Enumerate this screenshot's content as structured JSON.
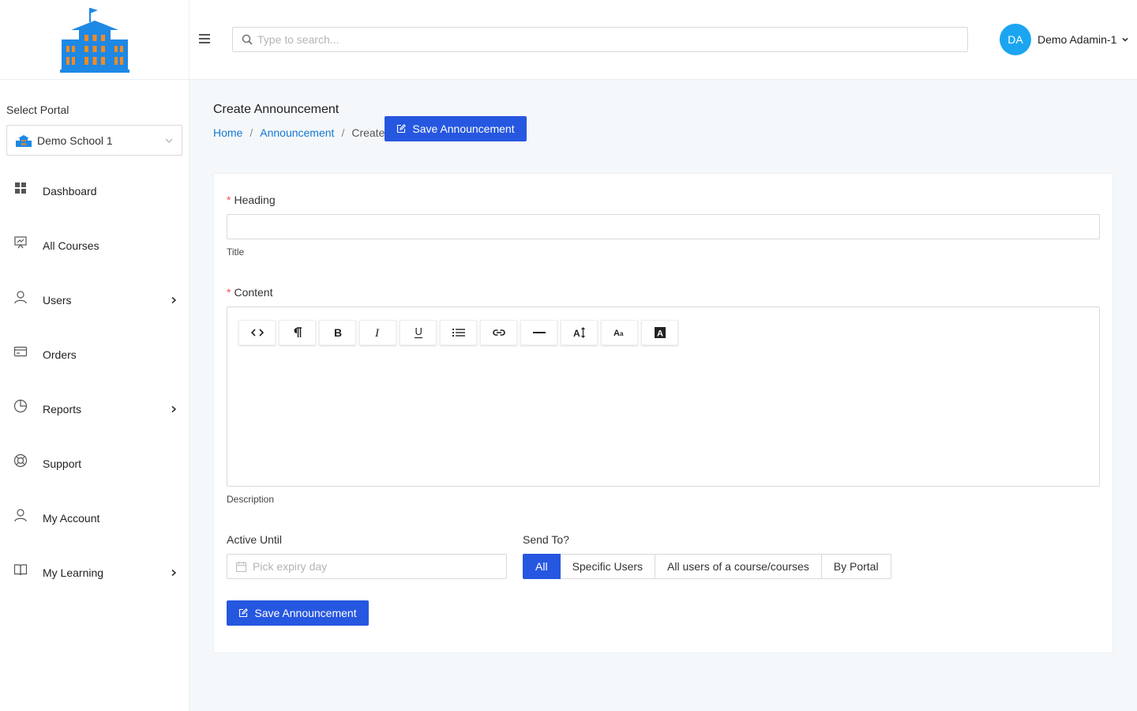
{
  "sidebar": {
    "portal_label": "Select Portal",
    "portal_value": "Demo School 1",
    "items": [
      {
        "label": "Dashboard",
        "icon": "dashboard-icon",
        "has_arrow": false
      },
      {
        "label": "All Courses",
        "icon": "presentation-chart-icon",
        "has_arrow": false
      },
      {
        "label": "Users",
        "icon": "user-icon",
        "has_arrow": true
      },
      {
        "label": "Orders",
        "icon": "credit-card-icon",
        "has_arrow": false
      },
      {
        "label": "Reports",
        "icon": "pie-chart-icon",
        "has_arrow": true
      },
      {
        "label": "Support",
        "icon": "lifebuoy-icon",
        "has_arrow": false
      },
      {
        "label": "My Account",
        "icon": "user-icon",
        "has_arrow": false
      },
      {
        "label": "My Learning",
        "icon": "book-icon",
        "has_arrow": true
      }
    ]
  },
  "header": {
    "search_placeholder": "Type to search...",
    "avatar_initials": "DA",
    "user_name": "Demo Adamin-1"
  },
  "page": {
    "title": "Create Announcement",
    "breadcrumb": {
      "home": "Home",
      "section": "Announcement",
      "current": "Create"
    },
    "save_label": "Save Announcement"
  },
  "form": {
    "heading_label": "Heading",
    "heading_help": "Title",
    "content_label": "Content",
    "content_help": "Description",
    "active_until_label": "Active Until",
    "date_placeholder": "Pick expiry day",
    "send_to_label": "Send To?",
    "send_to_options": [
      "All",
      "Specific Users",
      "All users of a course/courses",
      "By Portal"
    ],
    "send_to_selected": "All"
  },
  "colors": {
    "primary": "#2657e0",
    "avatar": "#1ba5f0",
    "link": "#1677d2",
    "required": "#ff4d4f"
  }
}
